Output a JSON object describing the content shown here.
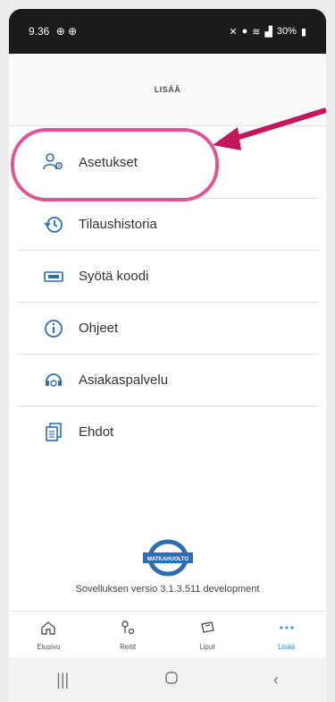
{
  "status": {
    "time": "9.36",
    "battery": "30%"
  },
  "header": {
    "title": "LISÄÄ"
  },
  "menu": {
    "items": [
      {
        "label": "Asetukset",
        "icon": "user-settings-icon"
      },
      {
        "label": "Tilaushistoria",
        "icon": "history-icon"
      },
      {
        "label": "Syötä koodi",
        "icon": "ticket-code-icon"
      },
      {
        "label": "Ohjeet",
        "icon": "info-icon"
      },
      {
        "label": "Asiakaspalvelu",
        "icon": "headset-icon"
      },
      {
        "label": "Ehdot",
        "icon": "documents-icon"
      }
    ]
  },
  "logo": {
    "text": "MATKAHUOLTO"
  },
  "footer": {
    "version": "Sovelluksen versio 3.1.3.511  development"
  },
  "tabs": [
    {
      "label": "Etusivu"
    },
    {
      "label": "Reitit"
    },
    {
      "label": "Liput"
    },
    {
      "label": "Lisää"
    }
  ],
  "colors": {
    "accent": "#2e88c8",
    "highlight": "#e05596",
    "brand": "#2d6db4"
  }
}
